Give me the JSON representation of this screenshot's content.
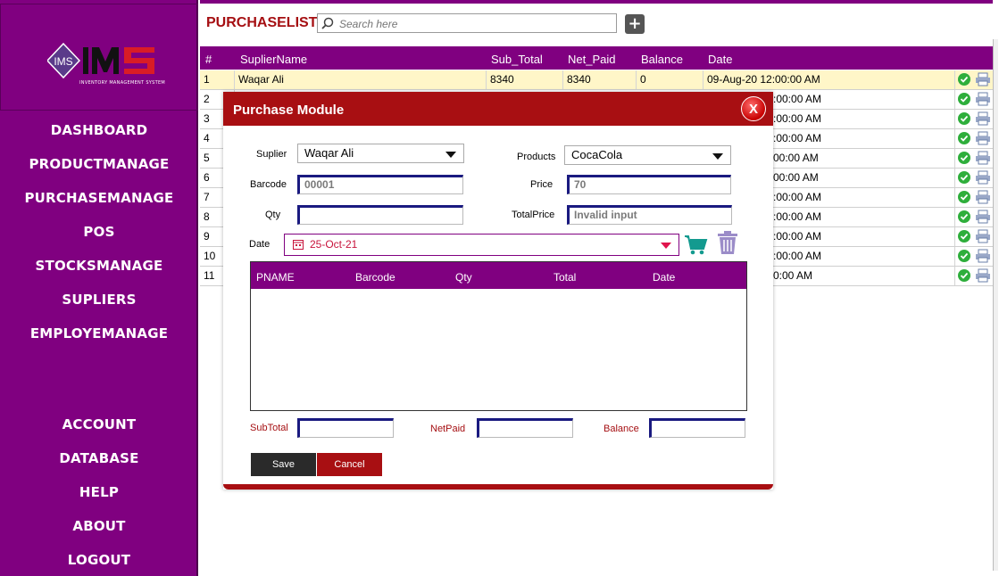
{
  "logo": {
    "mark": "IMS",
    "tagline": "INVENTORY MANAGEMENT SYSTEM"
  },
  "nav": [
    "DASHBOARD",
    "PRODUCTMANAGE",
    "PURCHASEMANAGE",
    "POS",
    "STOCKSMANAGE",
    "SUPLIERS",
    "EMPLOYEMANAGE",
    "ACCOUNT",
    "DATABASE",
    "HELP",
    "ABOUT",
    "LOGOUT"
  ],
  "header": {
    "title": "PURCHASELIST",
    "search_placeholder": "Search here",
    "add_label": "+"
  },
  "grid": {
    "columns": [
      "#",
      "SuplierName",
      "Sub_Total",
      "Net_Paid",
      "Balance",
      "Date"
    ],
    "first_row": {
      "num": "1",
      "name": "Waqar Ali",
      "sub": "8340",
      "net": "8340",
      "bal": "0",
      "date": "09-Aug-20 12:00:00 AM"
    },
    "rows": [
      {
        "num": "2",
        "date_tail": ":00:00 AM"
      },
      {
        "num": "3",
        "date_tail": ":00:00 AM"
      },
      {
        "num": "4",
        "date_tail": ":00:00 AM"
      },
      {
        "num": "5",
        "date_tail": "00:00 AM"
      },
      {
        "num": "6",
        "date_tail": "00:00 AM"
      },
      {
        "num": "7",
        "date_tail": ":00:00 AM"
      },
      {
        "num": "8",
        "date_tail": ":00:00 AM"
      },
      {
        "num": "9",
        "date_tail": ":00:00 AM"
      },
      {
        "num": "10",
        "date_tail": ":00:00 AM"
      },
      {
        "num": "11",
        "date_tail": "0:00 AM"
      }
    ]
  },
  "dialog": {
    "title": "Purchase Module",
    "close_label": "X",
    "suplier_label": "Suplier",
    "suplier_value": "Waqar Ali",
    "products_label": "Products",
    "products_value": "CocaCola",
    "barcode_label": "Barcode",
    "barcode_value": "00001",
    "price_label": "Price",
    "price_value": "70",
    "qty_label": "Qty",
    "qty_value": "",
    "totalprice_label": "TotalPrice",
    "totalprice_value": "Invalid input",
    "date_label": "Date",
    "date_value": "25-Oct-21",
    "inner_columns": [
      "PNAME",
      "Barcode",
      "Qty",
      "Total",
      "Date"
    ],
    "subtotal_label": "SubTotal",
    "netpaid_label": "NetPaid",
    "balance_label": "Balance",
    "save_label": "Save",
    "cancel_label": "Cancel"
  },
  "colors": {
    "sidebar": "#800080",
    "accent": "#a80f12",
    "selected_row": "#fff6c8",
    "ok": "#2eae3b"
  }
}
